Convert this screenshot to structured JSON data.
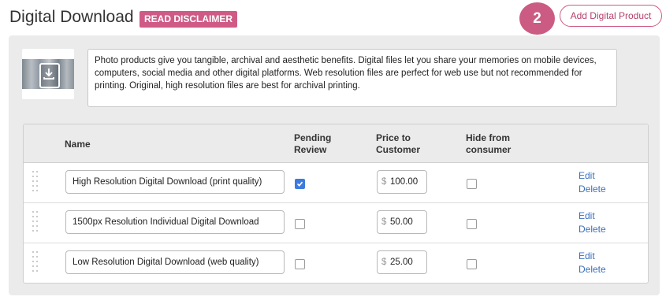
{
  "header": {
    "title": "Digital Download",
    "disclaimer_badge": "READ DISCLAIMER",
    "step_number": "2",
    "add_button": "Add Digital Product"
  },
  "intro": {
    "text": "Photo products give you tangible, archival and aesthetic benefits. Digital files let you share your memories on mobile devices, computers, social media and other digital platforms. Web resolution files are perfect for web use but not recommended for printing. Original, high resolution files are best for archival printing."
  },
  "table": {
    "columns": {
      "name": "Name",
      "pending_l1": "Pending",
      "pending_l2": "Review",
      "price_l1": "Price to",
      "price_l2": "Customer",
      "hide_l1": "Hide from",
      "hide_l2": "consumer"
    },
    "currency_symbol": "$",
    "edit_label": "Edit",
    "delete_label": "Delete",
    "rows": [
      {
        "name": "High Resolution Digital Download (print quality)",
        "pending_review": true,
        "price": "100.00",
        "hide": false
      },
      {
        "name": "1500px Resolution Individual Digital Download",
        "pending_review": false,
        "price": "50.00",
        "hide": false
      },
      {
        "name": "Low Resolution Digital Download (web quality)",
        "pending_review": false,
        "price": "25.00",
        "hide": false
      }
    ]
  },
  "colors": {
    "accent_pink": "#cf5a86",
    "link_blue": "#3a6fb8",
    "checkbox_blue": "#3d7be0"
  }
}
